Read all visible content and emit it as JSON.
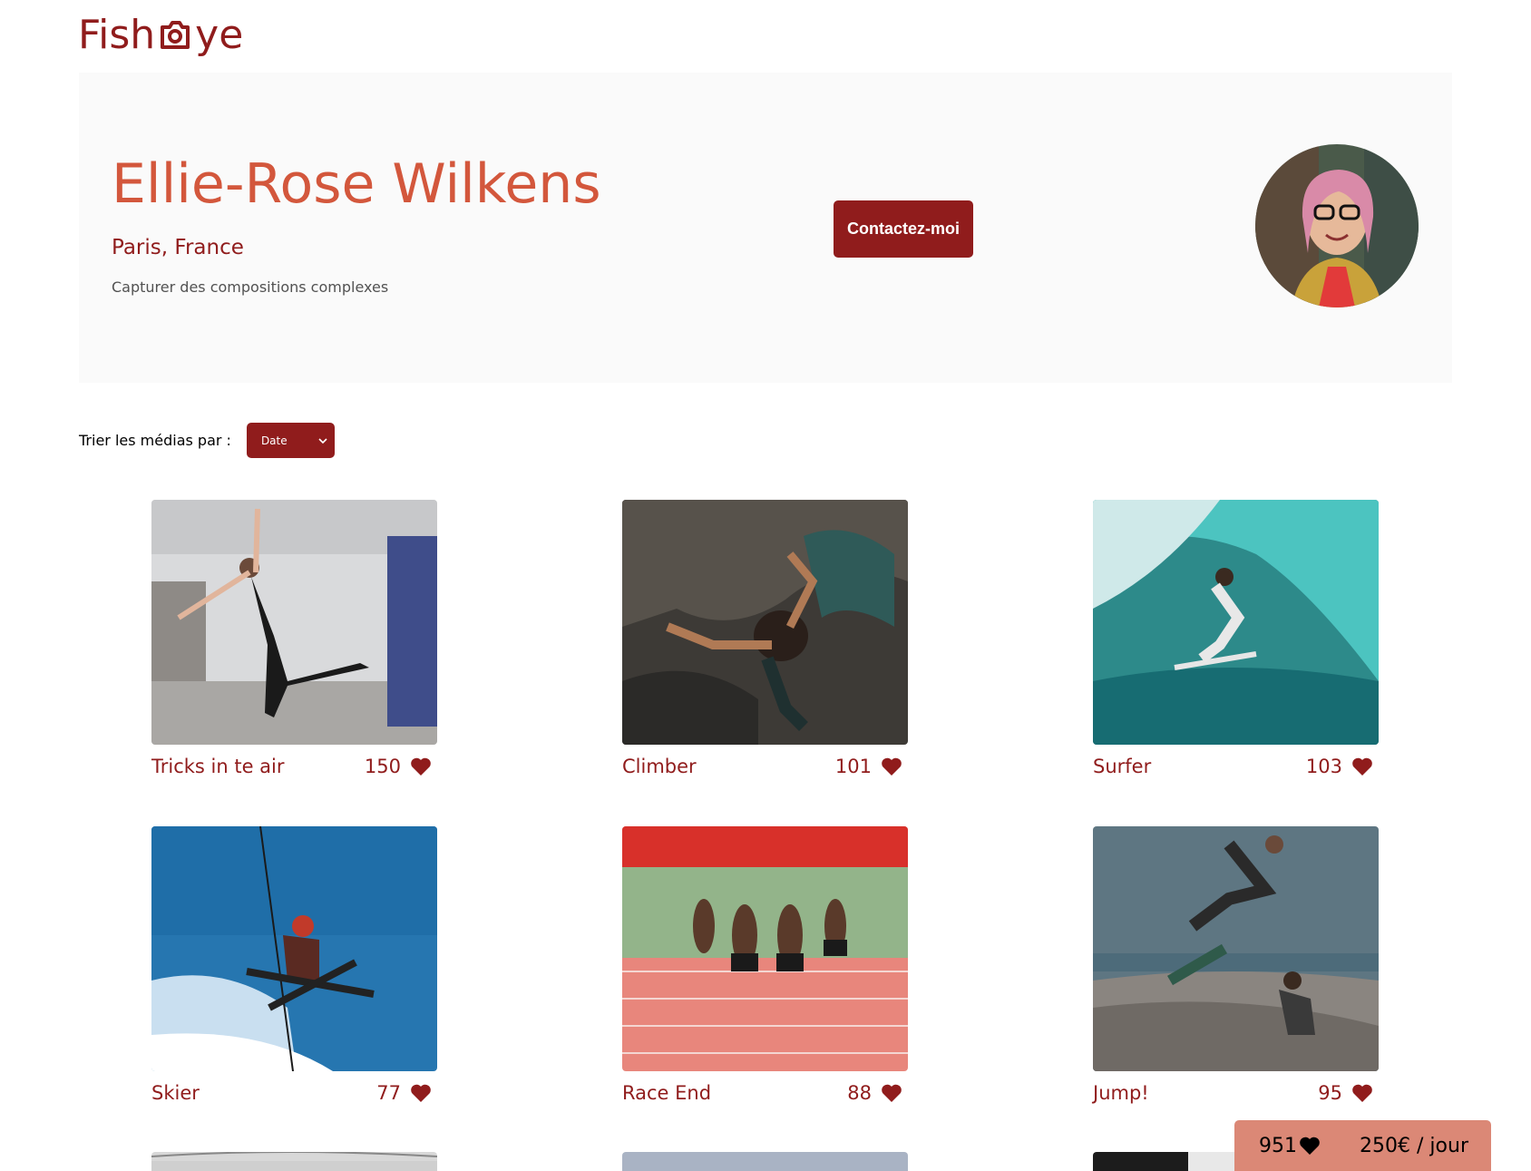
{
  "brand": {
    "logo_text_left": "Fish",
    "logo_text_right": "ye",
    "color": "#901c1c"
  },
  "photographer": {
    "name": "Ellie-Rose Wilkens",
    "location": "Paris, France",
    "tagline": "Capturer des compositions complexes"
  },
  "contact_button": {
    "label": "Contactez-moi"
  },
  "sort": {
    "label": "Trier les médias par :",
    "selected": "Date"
  },
  "media": [
    {
      "title": "Tricks in te air",
      "likes": "150"
    },
    {
      "title": "Climber",
      "likes": "101"
    },
    {
      "title": "Surfer",
      "likes": "103"
    },
    {
      "title": "Skier",
      "likes": "77"
    },
    {
      "title": "Race End",
      "likes": "88"
    },
    {
      "title": "Jump!",
      "likes": "95"
    }
  ],
  "stats": {
    "total_likes": "951",
    "price": "250€ / jour"
  },
  "colors": {
    "primary": "#901c1c",
    "secondary": "#d3573c",
    "stats_bg": "#db8876",
    "panel_bg": "#fafafa"
  }
}
